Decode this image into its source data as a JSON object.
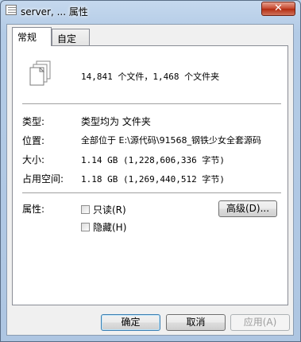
{
  "window": {
    "title": "server, ... 属性",
    "close_label": "✕"
  },
  "tabs": [
    {
      "label": "常规",
      "active": true
    },
    {
      "label": "自定义",
      "active": false
    }
  ],
  "general": {
    "summary": "14,841 个文件，1,468 个文件夹",
    "type_label": "类型:",
    "type_value": "类型均为 文件夹",
    "location_label": "位置:",
    "location_value": "全部位于 E:\\源代码\\91568_钢铁少女全套源码",
    "size_label": "大小:",
    "size_value": "1.14 GB (1,228,606,336 字节)",
    "size_on_disk_label": "占用空间:",
    "size_on_disk_value": "1.18 GB (1,269,440,512 字节)",
    "attributes_label": "属性:",
    "readonly_label": "只读(R)",
    "hidden_label": "隐藏(H)",
    "advanced_label": "高级(D)..."
  },
  "footer": {
    "ok_label": "确定",
    "cancel_label": "取消",
    "apply_label": "应用(A)"
  }
}
